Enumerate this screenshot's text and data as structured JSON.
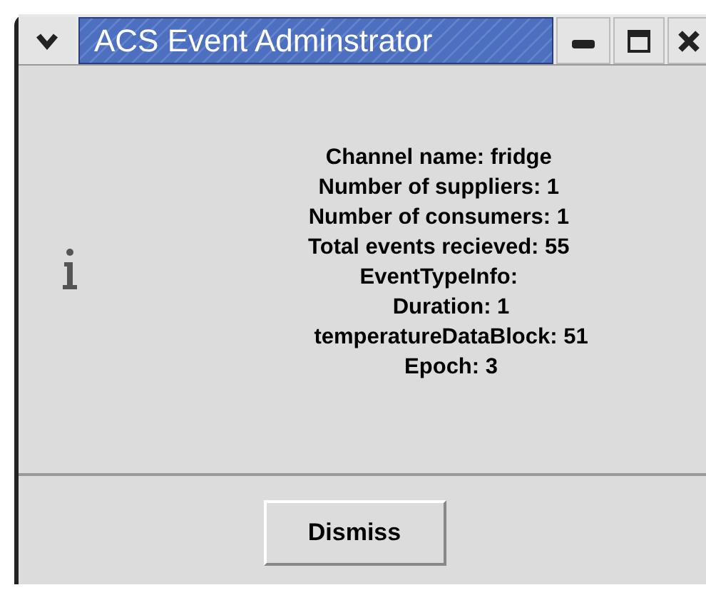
{
  "window": {
    "title": "ACS Event Adminstrator"
  },
  "message": {
    "lines": [
      "Channel name: fridge",
      "Number of suppliers: 1",
      "Number of consumers: 1",
      "Total events recieved: 55",
      "EventTypeInfo:",
      "    Duration: 1",
      "    temperatureDataBlock: 51",
      "    Epoch: 3"
    ]
  },
  "buttons": [
    "Dismiss"
  ]
}
